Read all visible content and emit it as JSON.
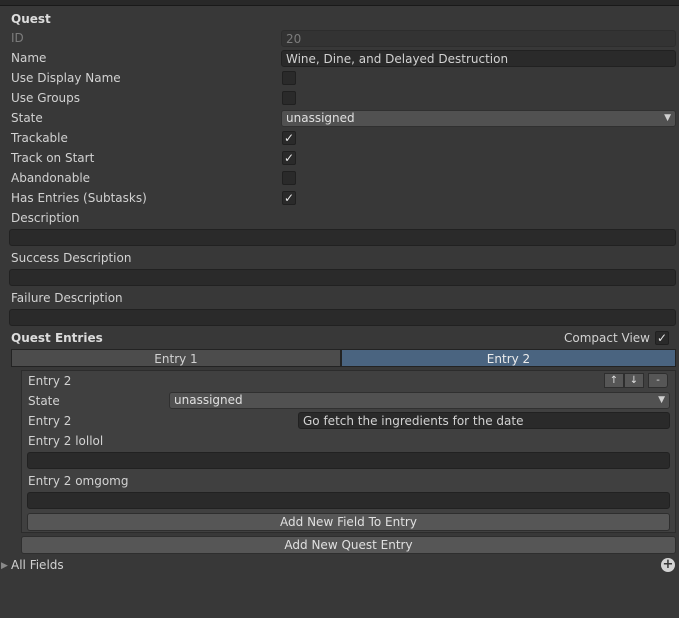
{
  "header": {
    "title": "Quest"
  },
  "fields": {
    "id": {
      "label": "ID",
      "value": "20"
    },
    "name": {
      "label": "Name",
      "value": "Wine, Dine, and Delayed Destruction"
    },
    "use_display_name": {
      "label": "Use Display Name",
      "checked": false
    },
    "use_groups": {
      "label": "Use Groups",
      "checked": false
    },
    "state": {
      "label": "State",
      "value": "unassigned"
    },
    "trackable": {
      "label": "Trackable",
      "checked": true
    },
    "track_on_start": {
      "label": "Track on Start",
      "checked": true
    },
    "abandonable": {
      "label": "Abandonable",
      "checked": false
    },
    "has_entries": {
      "label": "Has Entries (Subtasks)",
      "checked": true
    },
    "description": {
      "label": "Description",
      "value": ""
    },
    "success_description": {
      "label": "Success Description",
      "value": ""
    },
    "failure_description": {
      "label": "Failure Description",
      "value": ""
    }
  },
  "entries_section": {
    "title": "Quest Entries",
    "compact_view_label": "Compact View",
    "compact_view_checked": true,
    "tabs": [
      {
        "label": "Entry 1",
        "selected": false
      },
      {
        "label": "Entry 2",
        "selected": true
      }
    ],
    "entry": {
      "title": "Entry 2",
      "move_up": "↑",
      "move_down": "↓",
      "remove": "-",
      "state_label": "State",
      "state_value": "unassigned",
      "text_label": "Entry 2",
      "text_value": "Go fetch the ingredients for the date",
      "field1_label": "Entry 2 lollol",
      "field1_value": "",
      "field2_label": "Entry 2 omgomg",
      "field2_value": "",
      "add_field_button": "Add New Field To Entry"
    },
    "add_entry_button": "Add New Quest Entry"
  },
  "all_fields": {
    "label": "All Fields",
    "add_icon": "+"
  },
  "colors": {
    "background": "#383838",
    "field_bg": "#2a2a2a",
    "tab_selected": "#4a6480",
    "tab_unselected": "#4c4c4c"
  }
}
